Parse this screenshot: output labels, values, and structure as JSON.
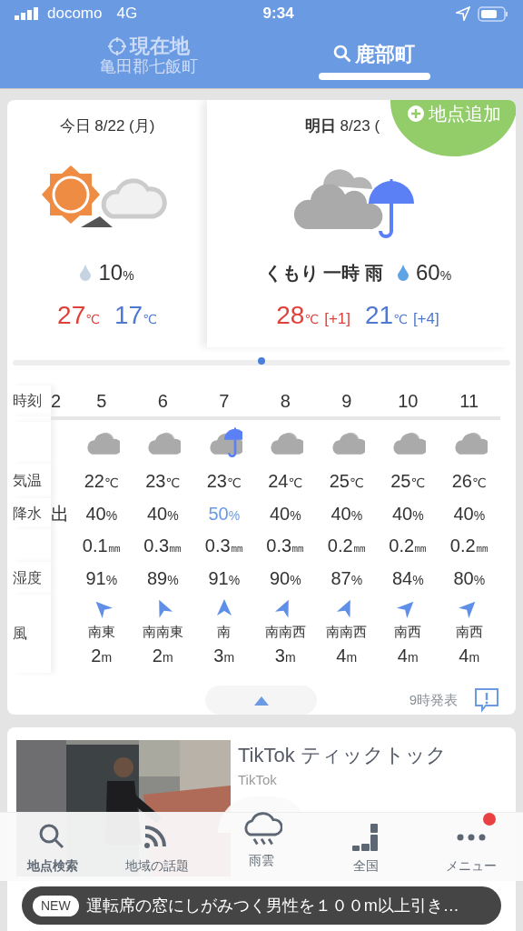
{
  "status_bar": {
    "carrier": "docomo",
    "network": "4G",
    "time": "9:34"
  },
  "location_tabs": [
    {
      "kind": "current",
      "title": "現在地",
      "subtitle": "亀田郡七飯町",
      "selected": false
    },
    {
      "kind": "search",
      "title": "鹿部町",
      "selected": true
    }
  ],
  "add_location": "地点追加",
  "days": [
    {
      "date": "今日 8/22 (月)",
      "kind": "sun-cloud",
      "rain_chance": [
        "10",
        "%"
      ],
      "high": [
        "27",
        "℃"
      ],
      "low": [
        "17",
        "℃"
      ],
      "color": "#c5d3e2"
    },
    {
      "date": "**明日** 8/23 (",
      "kind": "cloud-rain",
      "condition": "くもり 一時 雨",
      "rain_chance": [
        "60",
        "%"
      ],
      "high": [
        "28",
        "℃"
      ],
      "high_diff": "[+1]",
      "low": [
        "21",
        "℃"
      ],
      "low_diff": "[+4]",
      "color": "#5fa3e4"
    }
  ],
  "hourly": {
    "labels": {
      "time": "時刻",
      "temp": "気温",
      "precip": "降水",
      "humidity": "湿度",
      "wind": "風"
    },
    "partial": {
      "hour": "2",
      "precip": "出"
    },
    "hours": [
      {
        "hour": "5",
        "kind": "cloud",
        "temp": [
          "22",
          "℃"
        ],
        "precip": [
          "40",
          "%"
        ],
        "highlight": false,
        "rain": [
          "0.1",
          "㎜"
        ],
        "humidity": [
          "91",
          "%"
        ],
        "arrow": {
          "kind": "se"
        },
        "wind": "南東",
        "speed": [
          "2",
          "m"
        ]
      },
      {
        "hour": "6",
        "kind": "cloud",
        "temp": [
          "23",
          "℃"
        ],
        "precip": [
          "40",
          "%"
        ],
        "highlight": false,
        "rain": [
          "0.3",
          "㎜"
        ],
        "humidity": [
          "89",
          "%"
        ],
        "arrow": {
          "kind": "sse"
        },
        "wind": "南南東",
        "speed": [
          "2",
          "m"
        ]
      },
      {
        "hour": "7",
        "kind": "cloud-rain",
        "temp": [
          "23",
          "℃"
        ],
        "precip": [
          "50",
          "%"
        ],
        "highlight": true,
        "rain": [
          "0.3",
          "㎜"
        ],
        "humidity": [
          "91",
          "%"
        ],
        "arrow": {
          "kind": "s"
        },
        "wind": "南",
        "speed": [
          "3",
          "m"
        ]
      },
      {
        "hour": "8",
        "kind": "cloud",
        "temp": [
          "24",
          "℃"
        ],
        "precip": [
          "40",
          "%"
        ],
        "highlight": false,
        "rain": [
          "0.3",
          "㎜"
        ],
        "humidity": [
          "90",
          "%"
        ],
        "arrow": {
          "kind": "ssw"
        },
        "wind": "南南西",
        "speed": [
          "3",
          "m"
        ]
      },
      {
        "hour": "9",
        "kind": "cloud",
        "temp": [
          "25",
          "℃"
        ],
        "precip": [
          "40",
          "%"
        ],
        "highlight": false,
        "rain": [
          "0.2",
          "㎜"
        ],
        "humidity": [
          "87",
          "%"
        ],
        "arrow": {
          "kind": "ssw"
        },
        "wind": "南南西",
        "speed": [
          "4",
          "m"
        ]
      },
      {
        "hour": "10",
        "kind": "cloud",
        "temp": [
          "25",
          "℃"
        ],
        "precip": [
          "40",
          "%"
        ],
        "highlight": false,
        "rain": [
          "0.2",
          "㎜"
        ],
        "humidity": [
          "84",
          "%"
        ],
        "arrow": {
          "kind": "sw"
        },
        "wind": "南西",
        "speed": [
          "4",
          "m"
        ]
      },
      {
        "hour": "11",
        "kind": "cloud",
        "temp": [
          "26",
          "℃"
        ],
        "precip": [
          "40",
          "%"
        ],
        "highlight": false,
        "rain": [
          "0.2",
          "㎜"
        ],
        "humidity": [
          "80",
          "%"
        ],
        "arrow": {
          "kind": "sw"
        },
        "wind": "南西",
        "speed": [
          "4",
          "m"
        ]
      }
    ]
  },
  "issued": "9時発表",
  "ad": {
    "title": "TikTok ティックトック",
    "source": "TikTok"
  },
  "bottom_nav": [
    {
      "kind": "search",
      "label": "地点検索",
      "selected": true,
      "badge": false
    },
    {
      "kind": "feed",
      "label": "地域の話題",
      "selected": false,
      "badge": false
    },
    {
      "kind": "rain",
      "label": "雨雲",
      "selected": false,
      "badge": false
    },
    {
      "kind": "japan",
      "label": "全国",
      "selected": false,
      "badge": false
    },
    {
      "kind": "menu",
      "label": "メニュー",
      "selected": false,
      "badge": true
    }
  ],
  "news": {
    "badge": "NEW",
    "headline": "運転席の窓にしがみつく男性を１００m以上引き…"
  }
}
